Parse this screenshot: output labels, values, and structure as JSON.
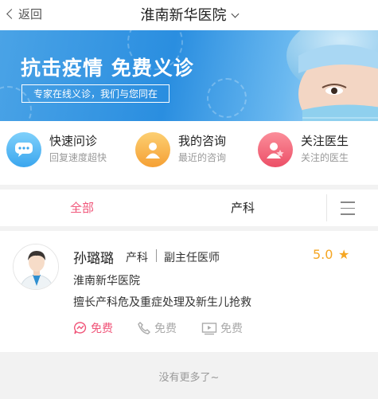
{
  "header": {
    "back_label": "返回",
    "title": "淮南新华医院"
  },
  "banner": {
    "headline": "抗击疫情  免费义诊",
    "subline": "专家在线义诊，我们与您同在"
  },
  "quick_actions": [
    {
      "title": "快速问诊",
      "subtitle": "回复速度超快",
      "icon": "chat-bubble-icon",
      "color": "#4fb3f0"
    },
    {
      "title": "我的咨询",
      "subtitle": "最近的咨询",
      "icon": "doctor-avatar-icon",
      "color": "#f9b24a"
    },
    {
      "title": "关注医生",
      "subtitle": "关注的医生",
      "icon": "followed-doctor-icon",
      "color": "#f26a7e"
    }
  ],
  "tabs": {
    "items": [
      "全部",
      "产科"
    ],
    "active_color": "#f0567a"
  },
  "doctor": {
    "name": "孙璐璐",
    "department": "产科",
    "title": "副主任医师",
    "rating": "5.0",
    "hospital": "淮南新华医院",
    "specialty": "擅长产科危及重症处理及新生儿抢救",
    "services": [
      {
        "label": "免费",
        "icon": "text-consult-icon",
        "active": true
      },
      {
        "label": "免费",
        "icon": "phone-consult-icon",
        "active": false
      },
      {
        "label": "免费",
        "icon": "video-consult-icon",
        "active": false
      }
    ]
  },
  "footer": {
    "text": "没有更多了~"
  }
}
